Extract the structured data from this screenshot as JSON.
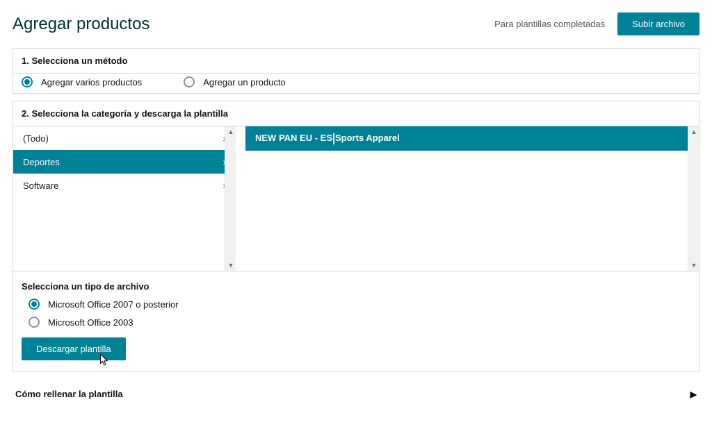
{
  "header": {
    "title": "Agregar productos",
    "completed_label": "Para plantillas completadas",
    "upload_button": "Subir archivo"
  },
  "step1": {
    "title": "1. Selecciona un método",
    "options": [
      {
        "label": "Agregar varios productos",
        "selected": true
      },
      {
        "label": "Agregar un producto",
        "selected": false
      }
    ]
  },
  "step2": {
    "title": "2. Selecciona la categoría y descarga la plantilla",
    "left_categories": [
      {
        "label": "(Todo)",
        "selected": false
      },
      {
        "label": "Deportes",
        "selected": true
      },
      {
        "label": "Software",
        "selected": false
      }
    ],
    "right_items": [
      {
        "prefix": "NEW PAN EU - ES",
        "suffix": "Sports Apparel",
        "selected": true
      }
    ],
    "file_type_title": "Selecciona un tipo de archivo",
    "file_types": [
      {
        "label": "Microsoft Office 2007 o posterior",
        "selected": true
      },
      {
        "label": "Microsoft Office 2003",
        "selected": false
      }
    ],
    "download_button": "Descargar plantilla"
  },
  "howto": {
    "title": "Cómo rellenar la plantilla"
  }
}
